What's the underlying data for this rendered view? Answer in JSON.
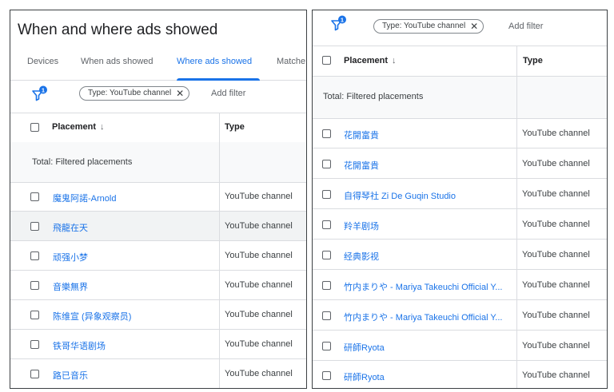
{
  "left": {
    "title": "When and where ads showed",
    "tabs": [
      {
        "label": "Devices"
      },
      {
        "label": "When ads showed"
      },
      {
        "label": "Where ads showed",
        "active": true
      },
      {
        "label": "Matche"
      }
    ],
    "filter_badge": "1",
    "filter_chip": "Type: YouTube channel",
    "chip_close": "✕",
    "add_filter": "Add filter",
    "col_placement": "Placement",
    "col_type": "Type",
    "sort_arrow": "↓",
    "total_label": "Total: Filtered placements",
    "rows": [
      {
        "name": "魔鬼阿諾-Arnold",
        "type": "YouTube channel"
      },
      {
        "name": "飛龍在天",
        "type": "YouTube channel"
      },
      {
        "name": "顽强小梦",
        "type": "YouTube channel"
      },
      {
        "name": "音樂無界",
        "type": "YouTube channel"
      },
      {
        "name": "陈维宣 (异象观察员)",
        "type": "YouTube channel"
      },
      {
        "name": "铁哥华语剧场",
        "type": "YouTube channel"
      },
      {
        "name": "路已音乐",
        "type": "YouTube channel"
      }
    ]
  },
  "right": {
    "filter_badge": "1",
    "filter_chip": "Type: YouTube channel",
    "chip_close": "✕",
    "add_filter": "Add filter",
    "col_placement": "Placement",
    "col_type": "Type",
    "sort_arrow": "↓",
    "total_label": "Total: Filtered placements",
    "rows": [
      {
        "name": "花開富貴",
        "type": "YouTube channel"
      },
      {
        "name": "花開富貴",
        "type": "YouTube channel"
      },
      {
        "name": "自得琴社 Zi De Guqin Studio",
        "type": "YouTube channel"
      },
      {
        "name": "羚羊剧场",
        "type": "YouTube channel"
      },
      {
        "name": "经典影视",
        "type": "YouTube channel"
      },
      {
        "name": "竹内まりや - Mariya Takeuchi Official Y...",
        "type": "YouTube channel"
      },
      {
        "name": "竹内まりや - Mariya Takeuchi Official Y...",
        "type": "YouTube channel"
      },
      {
        "name": "研師Ryota",
        "type": "YouTube channel"
      },
      {
        "name": "研師Ryota",
        "type": "YouTube channel"
      }
    ]
  },
  "colors": {
    "link": "#1a73e8",
    "accent": "#1a73e8",
    "divider": "#dadce0",
    "hover_row": "#f1f3f4"
  },
  "icons": {
    "filter": "filter-funnel-icon",
    "close": "close-icon",
    "sort": "arrow-down-icon"
  }
}
